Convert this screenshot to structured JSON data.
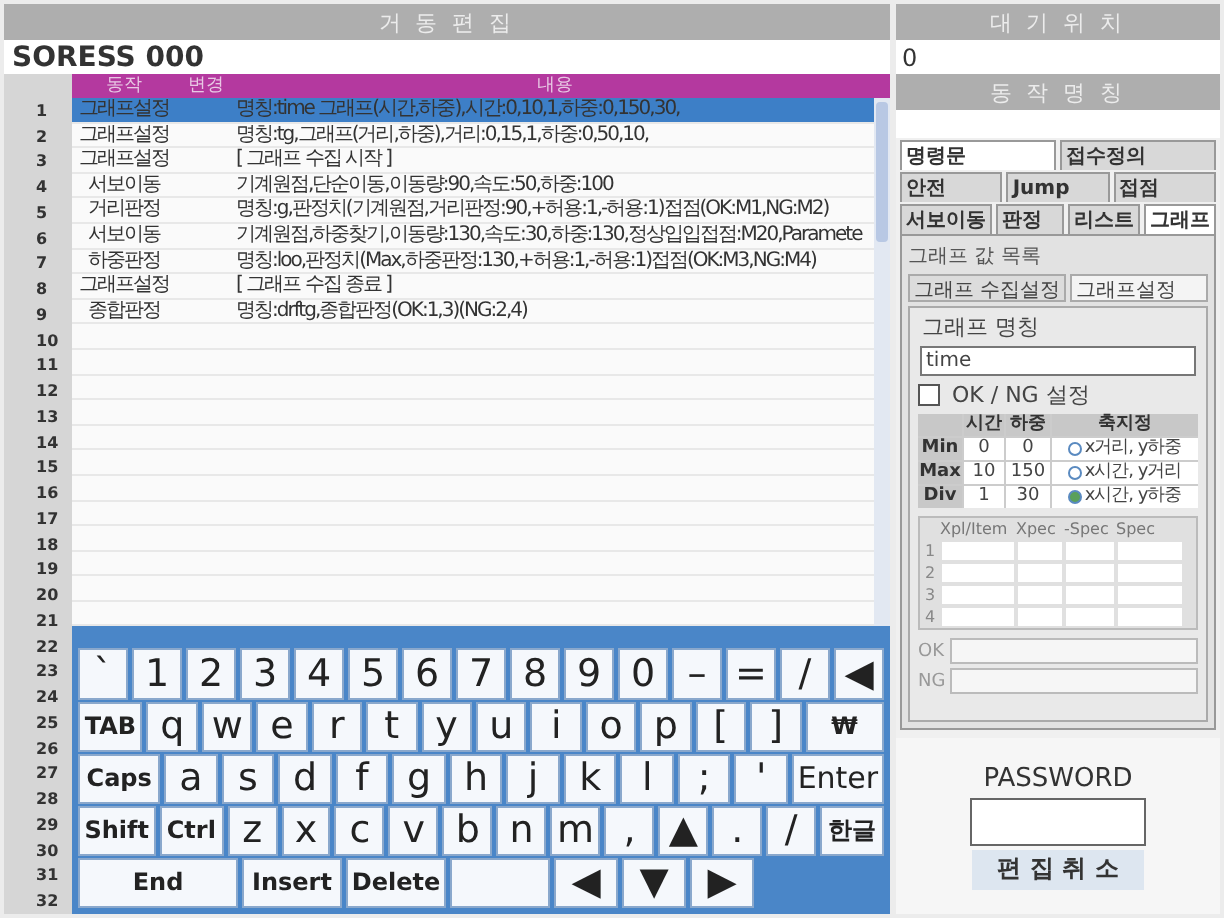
{
  "editor": {
    "title": "거 동 편 집",
    "program_name": "SORESS 000",
    "columns": [
      "동작",
      "변경",
      "내용"
    ],
    "rows": [
      {
        "number": "1",
        "action": "그래프설정",
        "content": "명칭:time 그래프(시간,하중),시간:0,10,1,하중:0,150,30,",
        "selected": true
      },
      {
        "number": "2",
        "action": "그래프설정",
        "content": "명칭:tg,그래프(거리,하중),거리:0,15,1,하중:0,50,10,",
        "selected": false
      },
      {
        "number": "3",
        "action": "그래프설정",
        "content": "[ 그래프 수집 시작 ]",
        "selected": false
      },
      {
        "number": "4",
        "action": "서보이동",
        "content": "기계원점,단순이동,이동량:90,속도:50,하중:100",
        "selected": false
      },
      {
        "number": "5",
        "action": "거리판정",
        "content": "명칭:g,판정치(기계원점,거리판정:90,+허용:1,-허용:1)접점(OK:M1,NG:M2)",
        "selected": false
      },
      {
        "number": "6",
        "action": "서보이동",
        "content": "기계원점,하중찾기,이동량:130,속도:30,하중:130,정상입입접점:M20,Paramete",
        "selected": false
      },
      {
        "number": "7",
        "action": "하중판정",
        "content": "명칭:loo,판정치(Max,하중판정:130,+허용:1,-허용:1)접점(OK:M3,NG:M4)",
        "selected": false
      },
      {
        "number": "8",
        "action": "그래프설정",
        "content": "[ 그래프 수집 종료 ]",
        "selected": false
      },
      {
        "number": "9",
        "action": "종합판정",
        "content": "명칭:drftg,종합판정(OK:1,3)(NG:2,4)",
        "selected": false
      }
    ],
    "empty_row_numbers": [
      "10",
      "11",
      "12",
      "13",
      "14",
      "15",
      "16",
      "17",
      "18",
      "19",
      "20",
      "21"
    ]
  },
  "keyboard": {
    "row_numbers": [
      "22",
      "23",
      "24",
      "25",
      "26",
      "27",
      "28",
      "29",
      "30",
      "31",
      "32"
    ],
    "key_rows": [
      {
        "keys": [
          {
            "label": "`",
            "kind": "char"
          },
          {
            "label": "1",
            "kind": "char"
          },
          {
            "label": "2",
            "kind": "char"
          },
          {
            "label": "3",
            "kind": "char"
          },
          {
            "label": "4",
            "kind": "char"
          },
          {
            "label": "5",
            "kind": "char"
          },
          {
            "label": "6",
            "kind": "char"
          },
          {
            "label": "7",
            "kind": "char"
          },
          {
            "label": "8",
            "kind": "char"
          },
          {
            "label": "9",
            "kind": "char"
          },
          {
            "label": "0",
            "kind": "char"
          },
          {
            "label": "–",
            "kind": "char"
          },
          {
            "label": "=",
            "kind": "char"
          },
          {
            "label": "/",
            "kind": "char"
          },
          {
            "label": "◀",
            "kind": "char"
          }
        ]
      },
      {
        "keys": [
          {
            "label": "TAB",
            "kind": "small"
          },
          {
            "label": "q",
            "kind": "char"
          },
          {
            "label": "w",
            "kind": "char"
          },
          {
            "label": "e",
            "kind": "char"
          },
          {
            "label": "r",
            "kind": "char"
          },
          {
            "label": "t",
            "kind": "char"
          },
          {
            "label": "y",
            "kind": "char"
          },
          {
            "label": "u",
            "kind": "char"
          },
          {
            "label": "i",
            "kind": "char"
          },
          {
            "label": "o",
            "kind": "char"
          },
          {
            "label": "p",
            "kind": "char"
          },
          {
            "label": "[",
            "kind": "char"
          },
          {
            "label": "]",
            "kind": "char"
          },
          {
            "label": "₩",
            "kind": "wide"
          }
        ]
      },
      {
        "keys": [
          {
            "label": "Caps",
            "kind": "wide"
          },
          {
            "label": "a",
            "kind": "char"
          },
          {
            "label": "s",
            "kind": "char"
          },
          {
            "label": "d",
            "kind": "char"
          },
          {
            "label": "f",
            "kind": "char"
          },
          {
            "label": "g",
            "kind": "char"
          },
          {
            "label": "h",
            "kind": "char"
          },
          {
            "label": "j",
            "kind": "char"
          },
          {
            "label": "k",
            "kind": "char"
          },
          {
            "label": "l",
            "kind": "char"
          },
          {
            "label": ";",
            "kind": "char"
          },
          {
            "label": "'",
            "kind": "char"
          },
          {
            "label": "Enter",
            "kind": "enter"
          }
        ]
      },
      {
        "keys": [
          {
            "label": "Shift",
            "kind": "wide"
          },
          {
            "label": "Ctrl",
            "kind": "small"
          },
          {
            "label": "z",
            "kind": "char"
          },
          {
            "label": "x",
            "kind": "char"
          },
          {
            "label": "c",
            "kind": "char"
          },
          {
            "label": "v",
            "kind": "char"
          },
          {
            "label": "b",
            "kind": "char"
          },
          {
            "label": "n",
            "kind": "char"
          },
          {
            "label": "m",
            "kind": "char"
          },
          {
            "label": ",",
            "kind": "char"
          },
          {
            "label": "▲",
            "kind": "char"
          },
          {
            "label": ".",
            "kind": "char"
          },
          {
            "label": "/",
            "kind": "char"
          },
          {
            "label": "한글",
            "kind": "small"
          }
        ]
      },
      {
        "keys": [
          {
            "label": "End",
            "kind": "long"
          },
          {
            "label": "Insert",
            "kind": "wide"
          },
          {
            "label": "Delete",
            "kind": "wide"
          },
          {
            "kind": "blank"
          },
          {
            "label": "◀",
            "kind": "char"
          },
          {
            "label": "▼",
            "kind": "char"
          },
          {
            "label": "▶",
            "kind": "char"
          },
          {
            "kind": "gap"
          }
        ]
      }
    ]
  },
  "standby": {
    "title": "대 기 위 치",
    "value": "0"
  },
  "motion_name": {
    "title": "동 작 명 칭"
  },
  "tab_rows": [
    [
      {
        "label": "명령문",
        "selected": true
      },
      {
        "label": "접수정의",
        "selected": false
      }
    ],
    [
      {
        "label": "안전",
        "selected": false
      },
      {
        "label": "Jump",
        "selected": false
      },
      {
        "label": "접점",
        "selected": false
      }
    ],
    [
      {
        "label": "서보이동",
        "selected": false
      },
      {
        "label": "판정",
        "selected": false
      },
      {
        "label": "리스트",
        "selected": false
      },
      {
        "label": "그래프",
        "selected": true
      }
    ]
  ],
  "graph_panel": {
    "group_title": "그래프 값 목록",
    "subtabs": [
      {
        "label": "그래프 수집설정",
        "selected": false
      },
      {
        "label": "그래프설정",
        "selected": true
      }
    ],
    "name_label": "그래프 명칭",
    "name_value": "time",
    "ok_ng": {
      "label": "OK / NG 설정",
      "checked": false
    },
    "axis_table": {
      "columns": [
        "시간",
        "하중",
        "축지정"
      ],
      "rows": [
        {
          "label": "Min",
          "time": "0",
          "load": "0",
          "axis": "x거리, y하중",
          "selected": false
        },
        {
          "label": "Max",
          "time": "10",
          "load": "150",
          "axis": "x시간, y거리",
          "selected": false
        },
        {
          "label": "Div",
          "time": "1",
          "load": "30",
          "axis": "x시간, y하중",
          "selected": true
        }
      ]
    },
    "spec_grid": {
      "columns": [
        "Xpl/Item",
        "Xpec",
        "-Spec",
        "Spec"
      ],
      "row_numbers": [
        "1",
        "2",
        "3",
        "4"
      ]
    },
    "ok_label": "OK",
    "ng_label": "NG"
  },
  "password": {
    "label": "PASSWORD",
    "button": "편 집 취 소"
  }
}
